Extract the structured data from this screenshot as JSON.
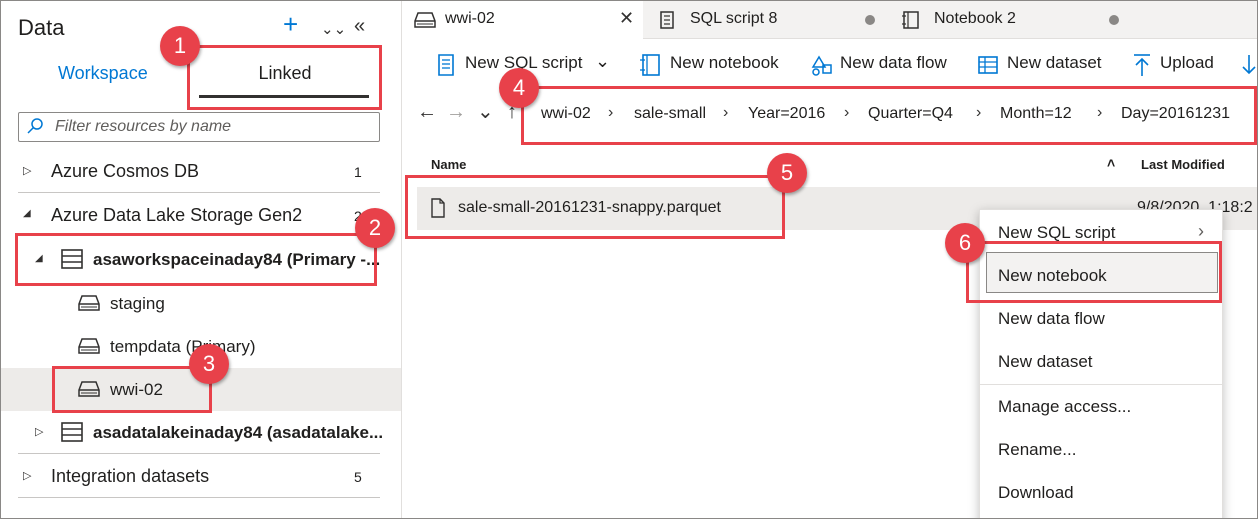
{
  "left_panel": {
    "title": "Data",
    "tabs": {
      "workspace": "Workspace",
      "linked": "Linked"
    },
    "filter_placeholder": "Filter resources by name",
    "tree": {
      "cosmos": {
        "label": "Azure Cosmos DB",
        "count": "1"
      },
      "adls": {
        "label": "Azure Data Lake Storage Gen2",
        "count": "2"
      },
      "primary_account": {
        "label": "asaworkspaceinaday84 (Primary -..."
      },
      "staging": {
        "label": "staging"
      },
      "tempdata": {
        "label": "tempdata (Primary)"
      },
      "wwi02": {
        "label": "wwi-02"
      },
      "second_account": {
        "label": "asadatalakeinaday84 (asadatalake..."
      },
      "integration": {
        "label": "Integration datasets",
        "count": "5"
      }
    }
  },
  "tabs": [
    {
      "label": "wwi-02"
    },
    {
      "label": "SQL script 8"
    },
    {
      "label": "Notebook 2"
    }
  ],
  "toolbar": {
    "new_sql_script": "New SQL script",
    "new_notebook": "New notebook",
    "new_data_flow": "New data flow",
    "new_dataset": "New dataset",
    "upload": "Upload"
  },
  "breadcrumb": [
    "wwi-02",
    "sale-small",
    "Year=2016",
    "Quarter=Q4",
    "Month=12",
    "Day=20161231"
  ],
  "file_list": {
    "col_name": "Name",
    "col_modified": "Last Modified",
    "files": [
      {
        "name": "sale-small-20161231-snappy.parquet",
        "modified": "9/8/2020, 1:18:2"
      }
    ]
  },
  "context_menu": {
    "items": [
      "New SQL script",
      "New notebook",
      "New data flow",
      "New dataset",
      "Manage access...",
      "Rename...",
      "Download"
    ]
  },
  "annotations": [
    "1",
    "2",
    "3",
    "4",
    "5",
    "6"
  ],
  "colors": {
    "accent": "#0078d4",
    "annotation": "#e8414a"
  }
}
